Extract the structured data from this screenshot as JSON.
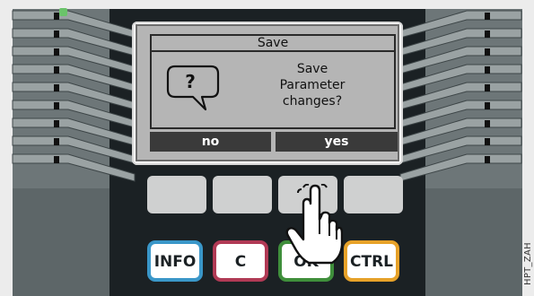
{
  "dialog": {
    "title": "Save",
    "message_line1": "Save",
    "message_line2": "Parameter",
    "message_line3": "changes?",
    "icon_symbol": "?"
  },
  "softkeys": {
    "no": "no",
    "yes": "yes"
  },
  "hard_keys": {
    "info": "INFO",
    "c": "C",
    "ok": "OK",
    "ctrl": "CTRL"
  },
  "side_code": "HPT_ZAH",
  "colors": {
    "info": "#3a97c9",
    "c": "#b13a55",
    "ok": "#3f8f3b",
    "ctrl": "#e7a229",
    "led": "#6ac36a"
  },
  "icons": [
    "question-bubble-icon",
    "pointing-hand-icon",
    "status-led-icon"
  ]
}
